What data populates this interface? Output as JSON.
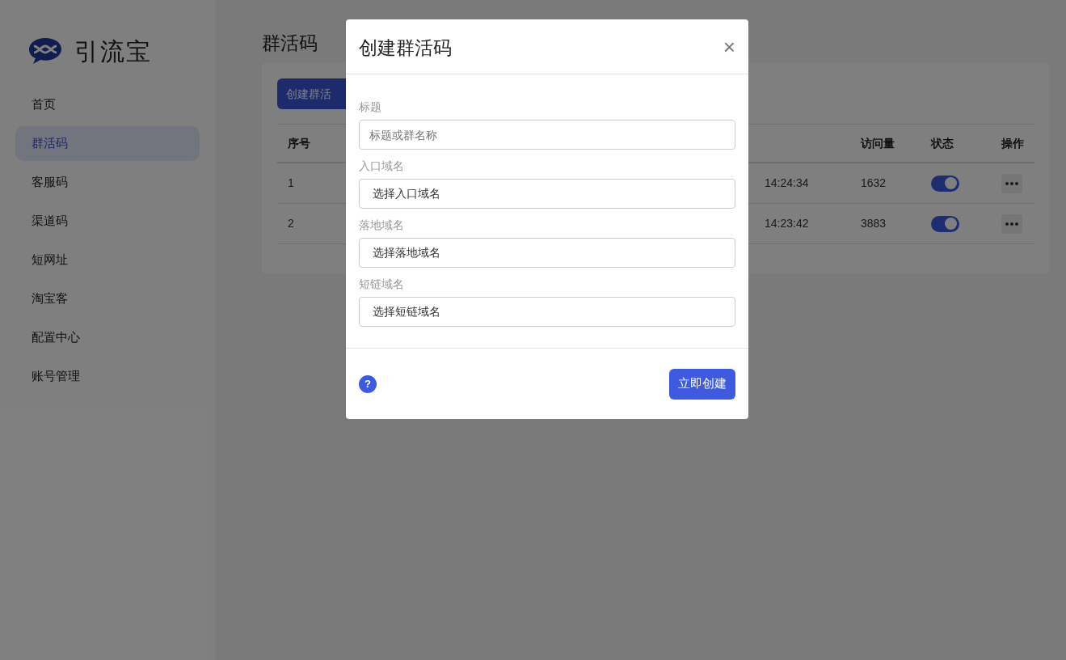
{
  "brand": {
    "name": "引流宝"
  },
  "sidebar": {
    "items": [
      {
        "label": "首页",
        "selected": false
      },
      {
        "label": "群活码",
        "selected": true
      },
      {
        "label": "客服码",
        "selected": false
      },
      {
        "label": "渠道码",
        "selected": false
      },
      {
        "label": "短网址",
        "selected": false
      },
      {
        "label": "淘宝客",
        "selected": false
      },
      {
        "label": "配置中心",
        "selected": false
      },
      {
        "label": "账号管理",
        "selected": false
      }
    ]
  },
  "page": {
    "title": "群活码",
    "create_button": "创建群活"
  },
  "table": {
    "columns": [
      "序号",
      "访问量",
      "状态",
      "操作"
    ],
    "rows": [
      {
        "index": "1",
        "time": "14:24:34",
        "visits": "1632",
        "enabled": true
      },
      {
        "index": "2",
        "time": "14:23:42",
        "visits": "3883",
        "enabled": true
      }
    ]
  },
  "dialog": {
    "title": "创建群活码",
    "close": "×",
    "fields": [
      {
        "kind": "input",
        "label": "标题",
        "placeholder": "标题或群名称"
      },
      {
        "kind": "select",
        "label": "入口域名",
        "value": "选择入口域名"
      },
      {
        "kind": "select",
        "label": "落地域名",
        "value": "选择落地域名"
      },
      {
        "kind": "select",
        "label": "短链域名",
        "value": "选择短链域名"
      }
    ],
    "help": "?",
    "submit": "立即创建"
  }
}
